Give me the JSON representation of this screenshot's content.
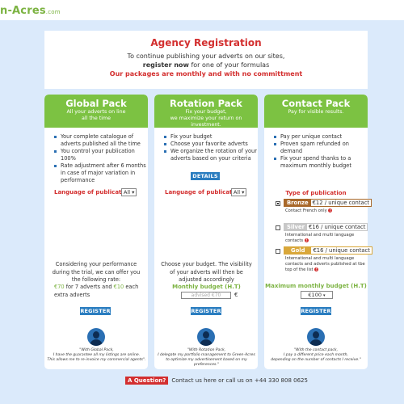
{
  "header": {
    "logo_text": "n-Acres",
    "logo_domain": ".com"
  },
  "intro": {
    "title": "Agency Registration",
    "line1": "To continue publishing your adverts on our sites,",
    "line2_bold": "register now",
    "line2_rest": " for one of your formulas",
    "line3": "Our packages are monthly and with no committment"
  },
  "global": {
    "title": "Global Pack",
    "subtitle1": "All your adverts on line",
    "subtitle2": "all the time",
    "bullets": [
      "Your complete catalogue of adverts published all the time",
      "You control your publication 100%",
      "Rate adjustment after 6 months in case of major variation in performance"
    ],
    "lang_label": "Language of publication",
    "lang_value": "All ▾",
    "offer_text": "Considering your performance during the trial, we can offer you the following rate:",
    "price1": "€70",
    "price_mid": " for 7 adverts and ",
    "price2": "€10",
    "price_end": " each extra adverts",
    "register": "REGISTER",
    "quote1": "\"With Global Pack,",
    "quote2": "I have the guarantee all my listings are online.",
    "quote3": "This allows me to re-invoice my commercial agents\"."
  },
  "rotation": {
    "title": "Rotation Pack",
    "subtitle1": "Fix your budget,",
    "subtitle2": "we maximize your return on investment.",
    "bullets": [
      "Fix your budget",
      "Choose your favorite adverts",
      "We organize the rotation of your adverts based on your criteria"
    ],
    "details": "DETAILS",
    "lang_label": "Language of publication",
    "lang_value": "All ▾",
    "budget_text": "Choose your budget. The visibility of your adverts will then be adjusted accordingly",
    "budget_label": "Monthly budget (H.T)",
    "budget_placeholder": "advised €70",
    "currency": "€",
    "register": "REGISTER",
    "quote1": "\"With Rotation Pack,",
    "quote2": "I delegate my portfolio management to Green-Acres",
    "quote3": "to optimize my advertisement based on my preferences.\""
  },
  "contact": {
    "title": "Contact Pack",
    "subtitle1": "Pay for visible results.",
    "bullets": [
      "Pay per unique contact",
      "Proven spam refunded on demand",
      "Fix your spend thanks to a maximum monthly budget"
    ],
    "type_label": "Type of publication",
    "tiers": [
      {
        "name": "Bronze",
        "price": "€12 / unique contact",
        "desc": "Contact French only",
        "checked": true,
        "color": "#a8682a"
      },
      {
        "name": "Silver",
        "price": "€16 / unique contact",
        "desc": "International and multi language contacts",
        "checked": false,
        "color": "#c8c8c8"
      },
      {
        "name": "Gold",
        "price": "€16 / unique contact",
        "desc": "International and multi language contacts and adverts published at tbe top of the list",
        "checked": false,
        "color": "#d9a73a"
      }
    ],
    "max_label": "Maximum monthly budget (H.T)",
    "max_value": "€100",
    "register": "REGISTER",
    "quote1": "\"With the contact pack,",
    "quote2": "I pay a different price each month,",
    "quote3": "depending on the number of contacts I receive.\""
  },
  "footer": {
    "badge": "A Question?",
    "text": "Contact us here or call us on +44 330 808 0625"
  }
}
